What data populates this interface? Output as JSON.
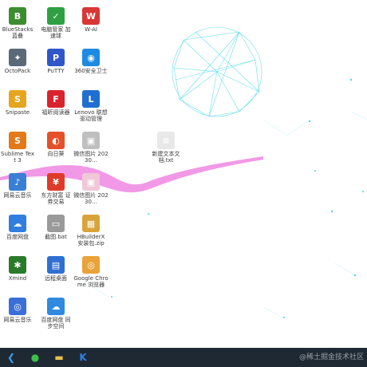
{
  "desktop": {
    "icons": [
      {
        "label": "BlueStacks 蓝叠",
        "icon": "bluestacks-icon",
        "color": "#3c8d2f",
        "glyph": "B"
      },
      {
        "label": "电脑管家 加速球",
        "icon": "checkmark-icon",
        "color": "#2ea043",
        "glyph": "✓"
      },
      {
        "label": "W-AI",
        "icon": "robot-icon",
        "color": "#d93636",
        "glyph": "W"
      },
      {
        "label": "OctoPack",
        "icon": "octopack-icon",
        "color": "#5b6a78",
        "glyph": "✦"
      },
      {
        "label": "PuTTY",
        "icon": "putty-icon",
        "color": "#2f57c9",
        "glyph": "P"
      },
      {
        "label": "360安全卫士",
        "icon": "shield-icon",
        "color": "#1d8be0",
        "glyph": "◉"
      },
      {
        "label": "Snipaste",
        "icon": "snipaste-icon",
        "color": "#e6a51f",
        "glyph": "S"
      },
      {
        "label": "福昕阅读器",
        "icon": "pdf-reader-icon",
        "color": "#d9232e",
        "glyph": "F"
      },
      {
        "label": "Lenovo 联想 驱动管理",
        "icon": "lenovo-icon",
        "color": "#1f6fd1",
        "glyph": "L"
      },
      {
        "label": "Sublime Text 3",
        "icon": "sublime-icon",
        "color": "#e37a1a",
        "glyph": "S"
      },
      {
        "label": "向日葵",
        "icon": "sunflower-icon",
        "color": "#e5502a",
        "glyph": "◐"
      },
      {
        "label": "微信图片 20230…",
        "icon": "image-file-icon",
        "color": "#bfbfbf",
        "glyph": "▣"
      },
      {
        "label": "新建文本文 档.txt",
        "icon": "text-file-icon",
        "color": "#e8e8e8",
        "glyph": "≡"
      },
      {
        "label": "网易云音乐",
        "icon": "music-icon",
        "color": "#3a7fd5",
        "glyph": "♪"
      },
      {
        "label": "东方财富 证券交易",
        "icon": "finance-icon",
        "color": "#e03a2a",
        "glyph": "¥"
      },
      {
        "label": "微信图片 20230…",
        "icon": "image-file-icon",
        "color": "#f0c8d8",
        "glyph": "▣"
      },
      {
        "label": "百度网盘",
        "icon": "cloud-icon",
        "color": "#2f7fe0",
        "glyph": "☁"
      },
      {
        "label": "截图.bat",
        "icon": "batch-file-icon",
        "color": "#9a9a9a",
        "glyph": "▭"
      },
      {
        "label": "HBuilderX 安装包.zip",
        "icon": "zip-archive-icon",
        "color": "#d8a43a",
        "glyph": "▦"
      },
      {
        "label": "Xmind",
        "icon": "xmind-icon",
        "color": "#2a7a2a",
        "glyph": "✱"
      },
      {
        "label": "远程桌面",
        "icon": "remote-desktop-icon",
        "color": "#2f6fd3",
        "glyph": "▤"
      },
      {
        "label": "Google Chrome 浏览器",
        "icon": "chrome-icon",
        "color": "#e8a33a",
        "glyph": "◎"
      },
      {
        "label": "网易云音乐",
        "icon": "music-icon",
        "color": "#3a6fd8",
        "glyph": "◎"
      },
      {
        "label": "百度网盘 同步空间",
        "icon": "cloud-sync-icon",
        "color": "#2f8ae0",
        "glyph": "☁"
      }
    ]
  },
  "taskbar": {
    "items": [
      {
        "name": "vscode-icon",
        "glyph": "❮",
        "color": "#3aa0e8"
      },
      {
        "name": "wechat-icon",
        "glyph": "●",
        "color": "#3cc04a"
      },
      {
        "name": "file-explorer-icon",
        "glyph": "▬",
        "color": "#e8c24a"
      },
      {
        "name": "app-k-icon",
        "glyph": "K",
        "color": "#2f80e8"
      }
    ]
  },
  "watermark": "@稀土掘金技术社区"
}
